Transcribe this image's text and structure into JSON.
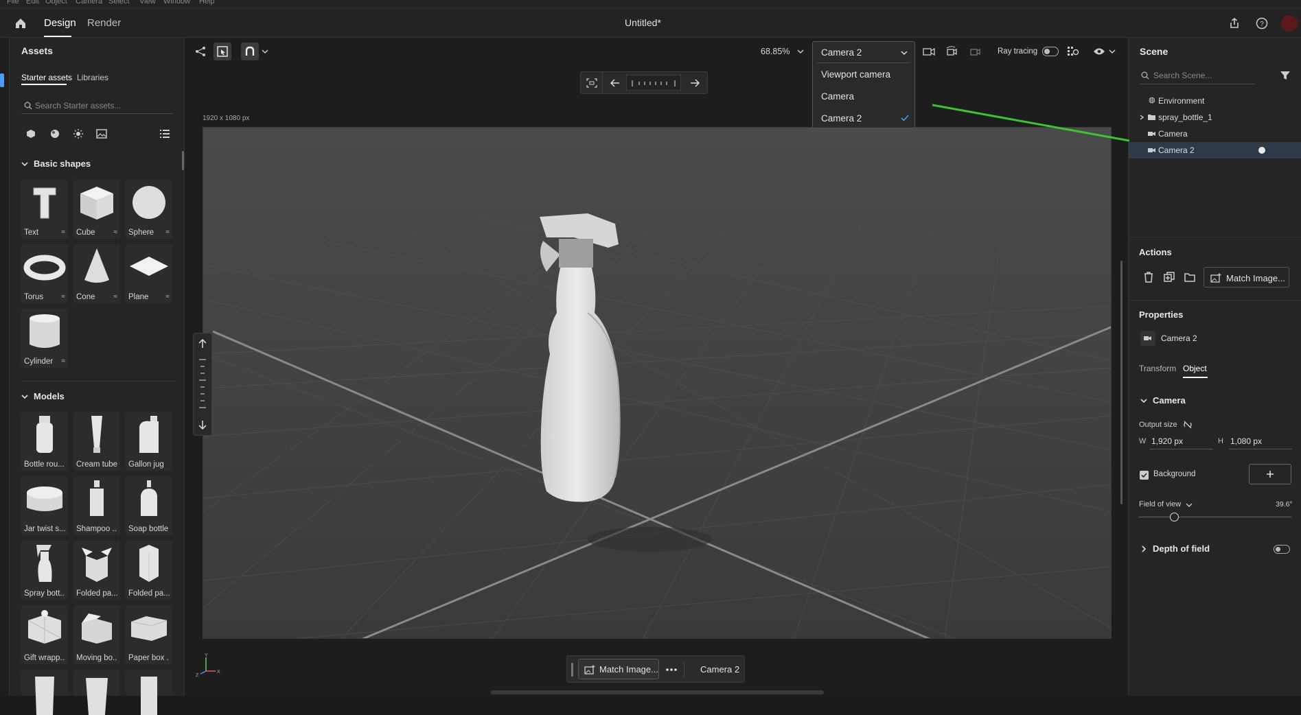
{
  "menubar": {
    "items": [
      "File",
      "Edit",
      "Object",
      "Camera",
      "Select",
      "View",
      "Window",
      "Help"
    ]
  },
  "header": {
    "tabs": [
      "Design",
      "Render"
    ],
    "active_tab": "Design",
    "doc_title": "Untitled*"
  },
  "toolbar": {
    "zoom": "68.85%",
    "camera_select": "Camera 2",
    "ray_tracing_label": "Ray tracing"
  },
  "camera_menu": {
    "options": [
      "Viewport camera",
      "Camera",
      "Camera 2"
    ],
    "selected": "Camera 2"
  },
  "assets": {
    "title": "Assets",
    "tabs": [
      "Starter assets",
      "Libraries"
    ],
    "search_placeholder": "Search Starter assets...",
    "basic_shapes_heading": "Basic shapes",
    "basic_shapes": [
      "Text",
      "Cube",
      "Sphere",
      "Torus",
      "Cone",
      "Plane",
      "Cylinder"
    ],
    "models_heading": "Models",
    "models": [
      "Bottle rou...",
      "Cream tube",
      "Gallon jug",
      "Jar twist s...",
      "Shampoo ...",
      "Soap bottle",
      "Spray bott...",
      "Folded pa...",
      "Folded pa...",
      "Gift wrapp...",
      "Moving bo...",
      "Paper box ..."
    ]
  },
  "viewport": {
    "resolution_label": "1920 x 1080 px"
  },
  "bottom_bar": {
    "match_label": "Match Image...",
    "camera_label": "Camera 2"
  },
  "scene": {
    "title": "Scene",
    "search_placeholder": "Search Scene...",
    "items": [
      {
        "label": "Environment",
        "icon": "globe-icon"
      },
      {
        "label": "spray_bottle_1",
        "icon": "folder-icon"
      },
      {
        "label": "Camera",
        "icon": "camera-icon"
      },
      {
        "label": "Camera 2",
        "icon": "camera-icon"
      }
    ]
  },
  "actions": {
    "title": "Actions",
    "match_label": "Match Image..."
  },
  "properties": {
    "title": "Properties",
    "object_name": "Camera 2",
    "tabs": [
      "Transform",
      "Object"
    ],
    "active_tab": "Object",
    "camera_heading": "Camera",
    "output_size_label": "Output size",
    "w_label": "W",
    "w_value": "1,920 px",
    "h_label": "H",
    "h_value": "1,080 px",
    "background_label": "Background",
    "fov_label": "Field of view",
    "fov_value": "39.6°",
    "dof_label": "Depth of field"
  },
  "colors": {
    "accent": "#4a9cf5",
    "highlight": "#2f3a48",
    "green_line": "#3dc430"
  }
}
